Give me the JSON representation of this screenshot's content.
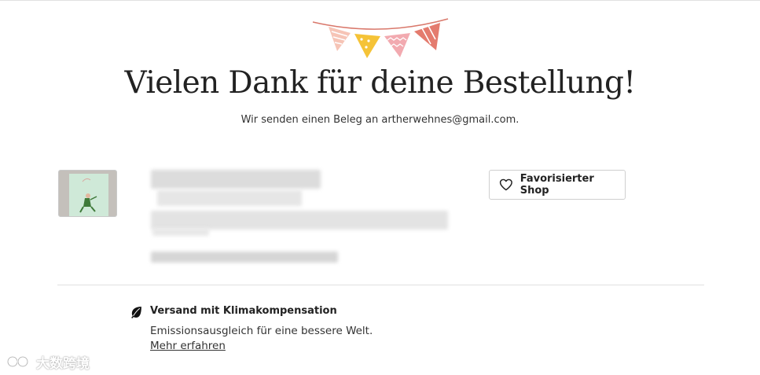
{
  "header": {
    "title": "Vielen Dank für deine Bestellung!",
    "subtitle": "Wir senden einen Beleg an artherwehnes@gmail.com."
  },
  "order": {
    "favorite_shop_label": "Favorisierter Shop"
  },
  "shipping": {
    "title": "Versand mit Klimakompensation",
    "description": "Emissionsausgleich für eine bessere Welt.",
    "link": "Mehr erfahren"
  },
  "watermark": {
    "text": "大数跨境"
  },
  "icons": {
    "bunting": "bunting-icon",
    "heart": "heart-icon",
    "leaf": "leaf-icon"
  },
  "colors": {
    "text": "#222222",
    "border": "#cfcfcf",
    "bunting_pink": "#f0b9a8",
    "bunting_yellow": "#f5c337",
    "bunting_red": "#e47b6e"
  }
}
